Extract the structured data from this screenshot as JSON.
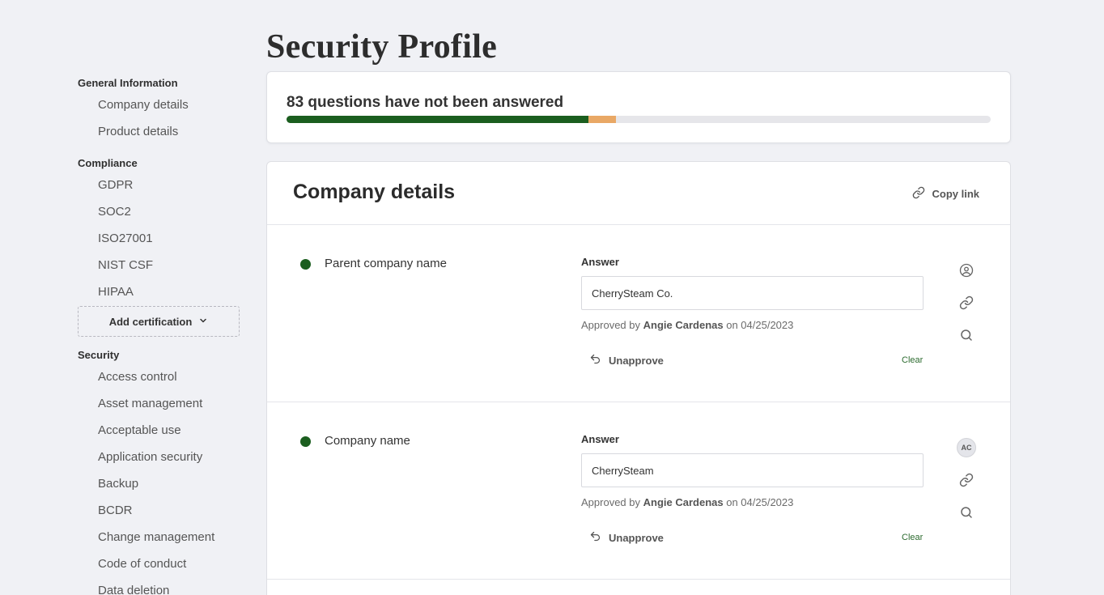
{
  "page": {
    "title": "Security Profile"
  },
  "progress": {
    "summary": "83 questions have not been answered",
    "approved_fraction": 0.429,
    "pending_fraction": 0.039,
    "colors": {
      "approved": "#1b5e1f",
      "pending": "#e9a865",
      "track": "#e6e6ea"
    }
  },
  "sidebar": {
    "groups": [
      {
        "heading": "General Information",
        "items": [
          "Company details",
          "Product details"
        ]
      },
      {
        "heading": "Compliance",
        "items": [
          "GDPR",
          "SOC2",
          "ISO27001",
          "NIST CSF",
          "HIPAA"
        ],
        "add_button": "Add certification"
      },
      {
        "heading": "Security",
        "items": [
          "Access control",
          "Asset management",
          "Acceptable use",
          "Application security",
          "Backup",
          "BCDR",
          "Change management",
          "Code of conduct",
          "Data deletion"
        ]
      }
    ]
  },
  "section": {
    "title": "Company details",
    "copy_link": "Copy link",
    "questions": [
      {
        "label": "Parent company name",
        "answer_label": "Answer",
        "value": "CherrySteam Co.",
        "approved_prefix": "Approved by",
        "approver": "Angie Cardenas",
        "approved_on": "on 04/25/2023",
        "unapprove": "Unapprove",
        "clear": "Clear",
        "status_color": "#1b5e1f",
        "assignee": {
          "type": "icon",
          "icon": "user-circle-icon"
        }
      },
      {
        "label": "Company name",
        "answer_label": "Answer",
        "value": "CherrySteam",
        "approved_prefix": "Approved by",
        "approver": "Angie Cardenas",
        "approved_on": "on 04/25/2023",
        "unapprove": "Unapprove",
        "clear": "Clear",
        "status_color": "#1b5e1f",
        "assignee": {
          "type": "avatar",
          "initials": "AC"
        }
      }
    ]
  }
}
